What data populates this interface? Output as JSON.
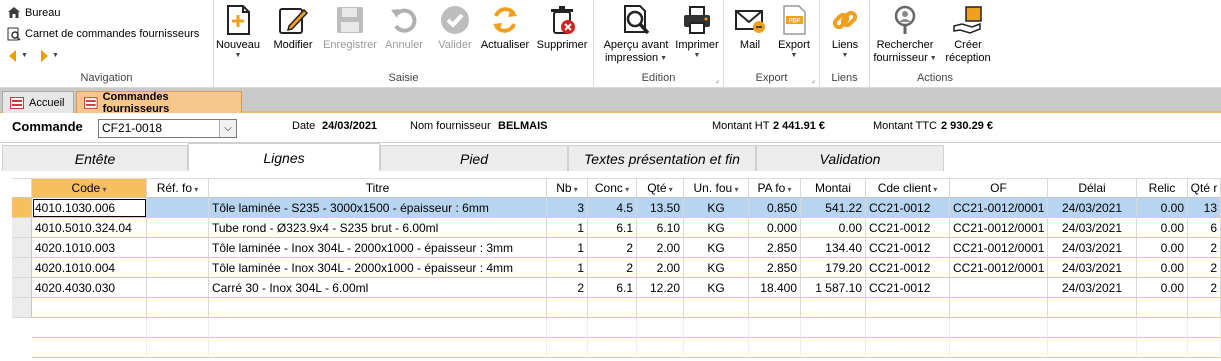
{
  "nav": {
    "home_label": "Bureau",
    "breadcrumb_label": "Carnet de commandes fournisseurs",
    "group_label": "Navigation"
  },
  "saisie": {
    "group_label": "Saisie",
    "nouveau": "Nouveau",
    "modifier": "Modifier",
    "enregistrer": "Enregistrer",
    "annuler": "Annuler",
    "valider": "Valider",
    "actualiser": "Actualiser",
    "supprimer": "Supprimer"
  },
  "edition": {
    "group_label": "Edition",
    "apercu_line1": "Aperçu avant",
    "apercu_line2": "impression",
    "imprimer": "Imprimer"
  },
  "export": {
    "group_label": "Export",
    "mail": "Mail",
    "export_label": "Export"
  },
  "liens": {
    "group_label": "Liens",
    "liens_label": "Liens"
  },
  "actions": {
    "group_label": "Actions",
    "rechercher_line1": "Rechercher",
    "rechercher_line2": "fournisseur",
    "creer_line1": "Créer",
    "creer_line2": "réception"
  },
  "doc_tabs": {
    "accueil": "Accueil",
    "commandes": "Commandes fournisseurs"
  },
  "header": {
    "commande_label": "Commande",
    "commande_value": "CF21-0018",
    "date_label": "Date",
    "date_value": "24/03/2021",
    "fournisseur_label": "Nom fournisseur",
    "fournisseur_value": "BELMAIS",
    "montant_ht_label": "Montant HT",
    "montant_ht_value": "2 441.91 €",
    "montant_ttc_label": "Montant TTC",
    "montant_ttc_value": "2 930.29 €"
  },
  "subtabs": [
    "Entête",
    "Lignes",
    "Pied",
    "Textes présentation et fin",
    "Validation"
  ],
  "grid": {
    "columns": [
      "Code",
      "Réf. fo",
      "Titre",
      "Nb",
      "Conc",
      "Qté",
      "Un. fou",
      "PA fo",
      "Montai",
      "Cde client",
      "OF",
      "Délai",
      "Relic",
      "Qté r"
    ],
    "rows": [
      [
        "4010.1030.006",
        "",
        "Tôle laminée - S235 - 3000x1500 - épaisseur : 6mm",
        "3",
        "4.5",
        "13.50",
        "KG",
        "0.850",
        "541.22",
        "CC21-0012",
        "CC21-0012/0001",
        "24/03/2021",
        "0.00",
        "13"
      ],
      [
        "4010.5010.324.04",
        "",
        "Tube rond - Ø323.9x4 - S235 brut - 6.00ml",
        "1",
        "6.1",
        "6.10",
        "KG",
        "0.000",
        "0.00",
        "CC21-0012",
        "CC21-0012/0001",
        "24/03/2021",
        "0.00",
        "6"
      ],
      [
        "4020.1010.003",
        "",
        "Tôle laminée - Inox 304L - 2000x1000 - épaisseur : 3mm",
        "1",
        "2",
        "2.00",
        "KG",
        "2.850",
        "134.40",
        "CC21-0012",
        "CC21-0012/0001",
        "24/03/2021",
        "0.00",
        "2"
      ],
      [
        "4020.1010.004",
        "",
        "Tôle laminée - Inox 304L - 2000x1000 - épaisseur : 4mm",
        "1",
        "2",
        "2.00",
        "KG",
        "2.850",
        "179.20",
        "CC21-0012",
        "CC21-0012/0001",
        "24/03/2021",
        "0.00",
        "2"
      ],
      [
        "4020.4030.030",
        "",
        "Carré 30 - Inox 304L - 6.00ml",
        "2",
        "6.1",
        "12.20",
        "KG",
        "18.400",
        "1 587.10",
        "CC21-0012",
        "",
        "24/03/2021",
        "0.00",
        "2"
      ]
    ]
  },
  "colors": {
    "accent_orange": "#f7bf5e",
    "selected_row": "#b7d4f1",
    "tab_active": "#f6c68a"
  }
}
